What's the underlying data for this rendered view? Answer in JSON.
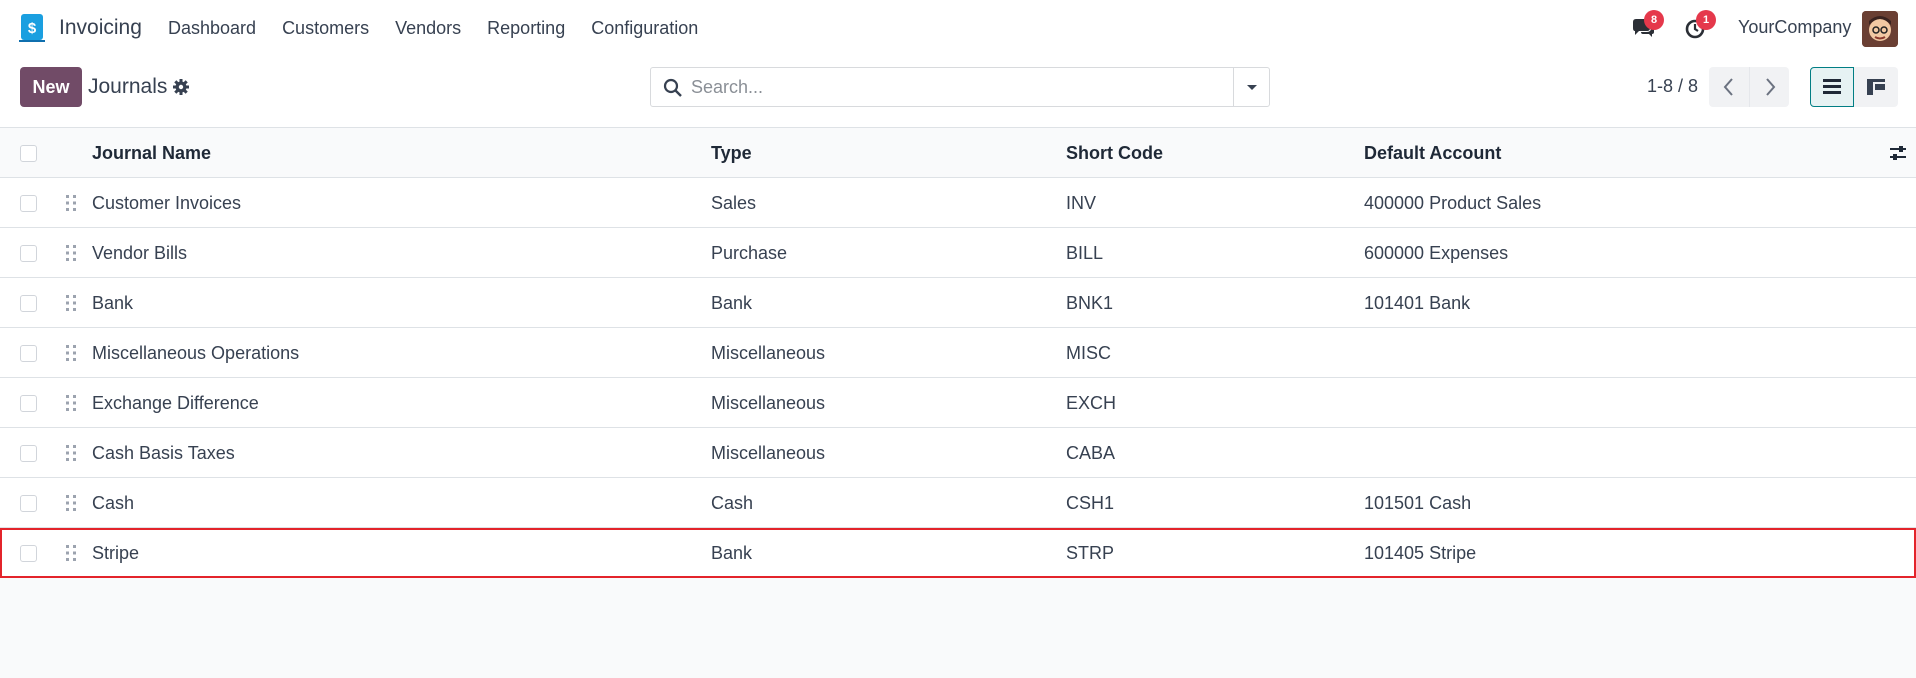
{
  "app": {
    "name": "Invoicing",
    "logo_icon": "invoicing-logo-icon"
  },
  "menu": [
    "Dashboard",
    "Customers",
    "Vendors",
    "Reporting",
    "Configuration"
  ],
  "systray": {
    "messages_count": "8",
    "activities_count": "1",
    "company": "YourCompany"
  },
  "control": {
    "new_label": "New",
    "breadcrumb": "Journals",
    "search_placeholder": "Search...",
    "pager": "1-8 / 8"
  },
  "table": {
    "columns": [
      "Journal Name",
      "Type",
      "Short Code",
      "Default Account"
    ],
    "rows": [
      {
        "name": "Customer Invoices",
        "type": "Sales",
        "code": "INV",
        "account": "400000 Product Sales"
      },
      {
        "name": "Vendor Bills",
        "type": "Purchase",
        "code": "BILL",
        "account": "600000 Expenses"
      },
      {
        "name": "Bank",
        "type": "Bank",
        "code": "BNK1",
        "account": "101401 Bank"
      },
      {
        "name": "Miscellaneous Operations",
        "type": "Miscellaneous",
        "code": "MISC",
        "account": ""
      },
      {
        "name": "Exchange Difference",
        "type": "Miscellaneous",
        "code": "EXCH",
        "account": ""
      },
      {
        "name": "Cash Basis Taxes",
        "type": "Miscellaneous",
        "code": "CABA",
        "account": ""
      },
      {
        "name": "Cash",
        "type": "Cash",
        "code": "CSH1",
        "account": "101501 Cash"
      },
      {
        "name": "Stripe",
        "type": "Bank",
        "code": "STRP",
        "account": "101405 Stripe"
      }
    ]
  },
  "colors": {
    "brand": "#714b67",
    "badge": "#e5384b",
    "highlight": "#e3242b",
    "active_view": "#017e84"
  }
}
